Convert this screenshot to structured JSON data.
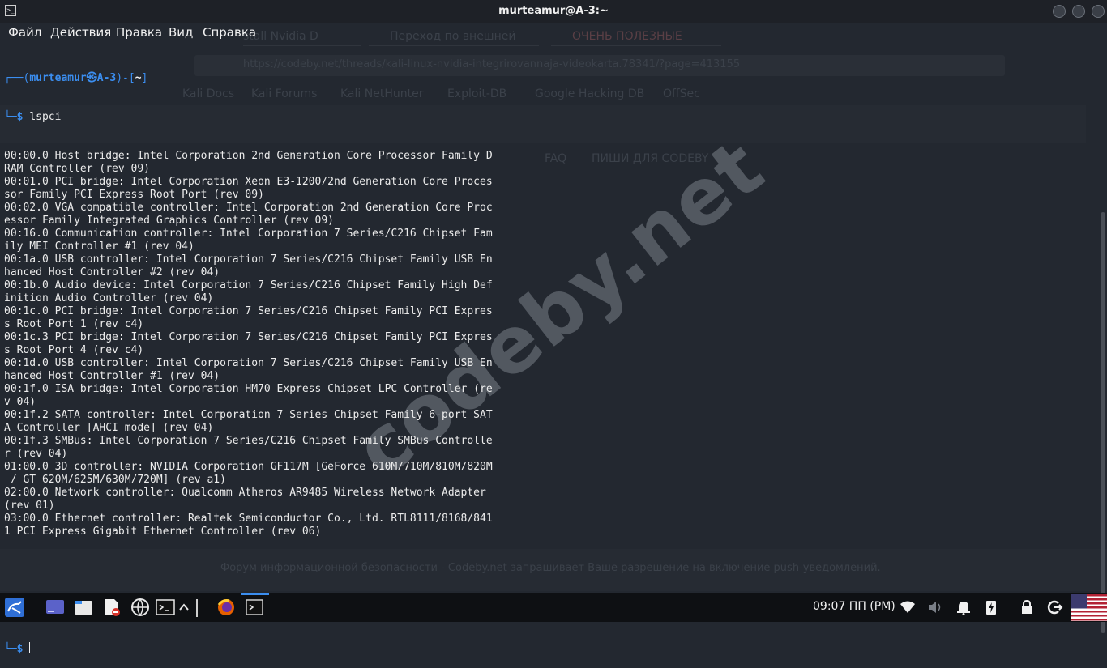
{
  "window": {
    "title": "murteamur@A-3:~",
    "icon": "terminal-icon"
  },
  "menu": {
    "items": [
      "Файл",
      "Действия",
      "Правка",
      "Вид",
      "Справка"
    ]
  },
  "background_browser": {
    "tabs": [
      "stall Nvidia D",
      "Переход по внешней",
      "ОЧЕНЬ ПОЛЕЗНЫЕ"
    ],
    "url": "https://codeby.net/threads/kali-linux-nvidia-integrirovannaja-videokarta.78341/?page=413155",
    "bookmarks": [
      "Kali Docs",
      "Kali Forums",
      "Kali NetHunter",
      "Exploit-DB",
      "Google Hacking DB",
      "OffSec"
    ],
    "nav": [
      "FAQ",
      "ПИШИ ДЛЯ CODEBY"
    ],
    "notification": "Форум информационной безопасности - Codeby.net запрашивает Ваше разрешение на включение push-уведомлений."
  },
  "terminal": {
    "prompt": {
      "user_host": "murteamur㉿A-3",
      "dir": "~",
      "symbol": "$"
    },
    "command": "lspci",
    "output": [
      "00:00.0 Host bridge: Intel Corporation 2nd Generation Core Processor Family D",
      "RAM Controller (rev 09)",
      "00:01.0 PCI bridge: Intel Corporation Xeon E3-1200/2nd Generation Core Proces",
      "sor Family PCI Express Root Port (rev 09)",
      "00:02.0 VGA compatible controller: Intel Corporation 2nd Generation Core Proc",
      "essor Family Integrated Graphics Controller (rev 09)",
      "00:16.0 Communication controller: Intel Corporation 7 Series/C216 Chipset Fam",
      "ily MEI Controller #1 (rev 04)",
      "00:1a.0 USB controller: Intel Corporation 7 Series/C216 Chipset Family USB En",
      "hanced Host Controller #2 (rev 04)",
      "00:1b.0 Audio device: Intel Corporation 7 Series/C216 Chipset Family High Def",
      "inition Audio Controller (rev 04)",
      "00:1c.0 PCI bridge: Intel Corporation 7 Series/C216 Chipset Family PCI Expres",
      "s Root Port 1 (rev c4)",
      "00:1c.3 PCI bridge: Intel Corporation 7 Series/C216 Chipset Family PCI Expres",
      "s Root Port 4 (rev c4)",
      "00:1d.0 USB controller: Intel Corporation 7 Series/C216 Chipset Family USB En",
      "hanced Host Controller #1 (rev 04)",
      "00:1f.0 ISA bridge: Intel Corporation HM70 Express Chipset LPC Controller (re",
      "v 04)",
      "00:1f.2 SATA controller: Intel Corporation 7 Series Chipset Family 6-port SAT",
      "A Controller [AHCI mode] (rev 04)",
      "00:1f.3 SMBus: Intel Corporation 7 Series/C216 Chipset Family SMBus Controlle",
      "r (rev 04)",
      "01:00.0 3D controller: NVIDIA Corporation GF117M [GeForce 610M/710M/810M/820M",
      " / GT 620M/625M/630M/720M] (rev a1)",
      "02:00.0 Network controller: Qualcomm Atheros AR9485 Wireless Network Adapter",
      "(rev 01)",
      "03:00.0 Ethernet controller: Realtek Semiconductor Co., Ltd. RTL8111/8168/841",
      "1 PCI Express Gigabit Ethernet Controller (rev 06)"
    ]
  },
  "watermark": "codeby.net",
  "taskbar": {
    "clock": "09:07 ПП (PM)",
    "apps": [
      "kali-menu-icon",
      "workspace-icon",
      "file-manager-icon",
      "text-editor-icon",
      "browser-globe-icon",
      "terminal-icon",
      "chevron-up-icon",
      "firefox-icon",
      "terminal-window-icon"
    ],
    "tray": [
      "network-icon",
      "volume-icon",
      "notifications-icon",
      "power-icon",
      "lock-icon",
      "logout-icon",
      "us-flag-icon"
    ]
  },
  "colors": {
    "background": "#232830",
    "prompt": "#3b8ef0",
    "text": "#ececec",
    "taskbar": "#0e1013"
  }
}
